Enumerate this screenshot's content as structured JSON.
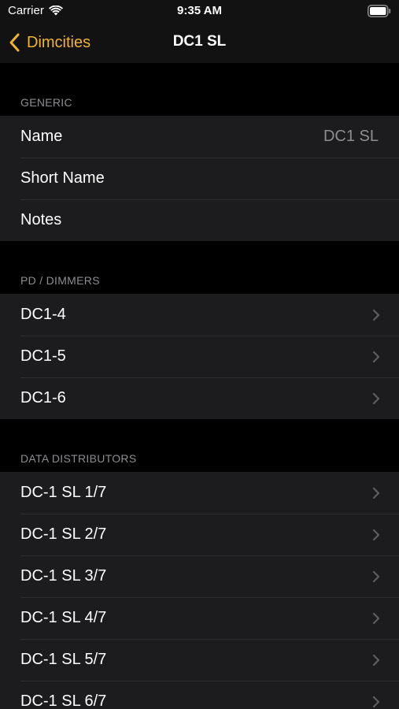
{
  "status_bar": {
    "carrier": "Carrier",
    "time": "9:35 AM"
  },
  "nav": {
    "back_label": "Dimcities",
    "title": "DC1 SL"
  },
  "colors": {
    "accent": "#f2b233",
    "background": "#000000",
    "cell": "#1c1c1e",
    "secondary_text": "#8d8d92"
  },
  "sections": {
    "generic": {
      "header": "GENERIC",
      "rows": [
        {
          "label": "Name",
          "value": "DC1 SL"
        },
        {
          "label": "Short Name"
        },
        {
          "label": "Notes"
        }
      ]
    },
    "dimmers": {
      "header": "PD / DIMMERS",
      "rows": [
        {
          "label": "DC1-4"
        },
        {
          "label": "DC1-5"
        },
        {
          "label": "DC1-6"
        }
      ]
    },
    "distributors": {
      "header": "DATA DISTRIBUTORS",
      "rows": [
        {
          "label": "DC-1 SL 1/7"
        },
        {
          "label": "DC-1 SL 2/7"
        },
        {
          "label": "DC-1 SL 3/7"
        },
        {
          "label": "DC-1 SL 4/7"
        },
        {
          "label": "DC-1 SL 5/7"
        },
        {
          "label": "DC-1 SL 6/7"
        }
      ]
    }
  }
}
